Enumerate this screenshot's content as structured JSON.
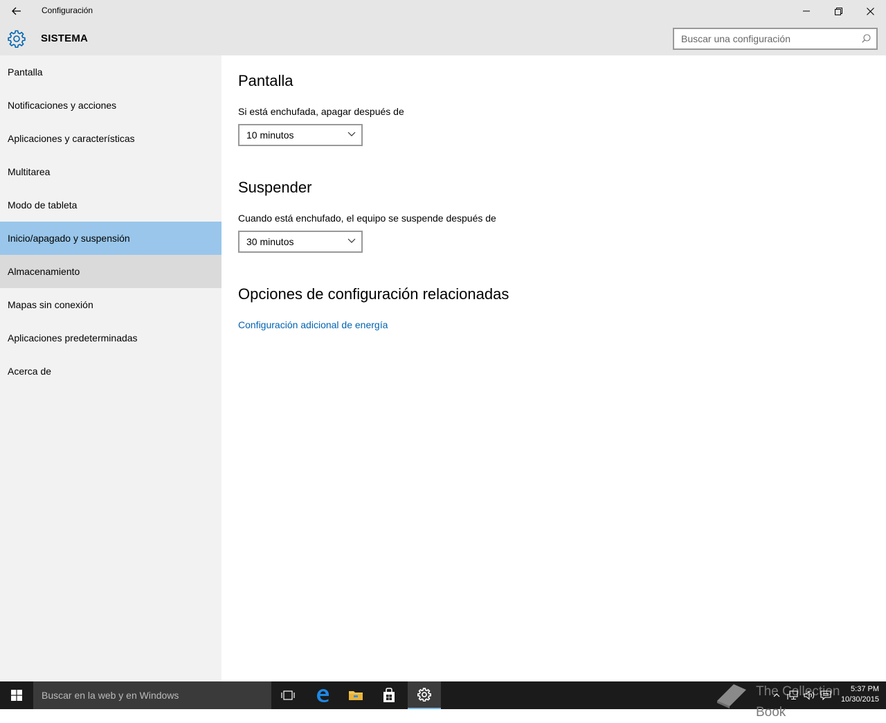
{
  "window": {
    "title": "Configuración",
    "section_title": "SISTEMA"
  },
  "search": {
    "placeholder": "Buscar una configuración"
  },
  "sidebar": {
    "items": [
      {
        "label": "Pantalla"
      },
      {
        "label": "Notificaciones y acciones"
      },
      {
        "label": "Aplicaciones y características"
      },
      {
        "label": "Multitarea"
      },
      {
        "label": "Modo de tableta"
      },
      {
        "label": "Inicio/apagado y suspensión"
      },
      {
        "label": "Almacenamiento"
      },
      {
        "label": "Mapas sin conexión"
      },
      {
        "label": "Aplicaciones predeterminadas"
      },
      {
        "label": "Acerca de"
      }
    ],
    "selected_label": "Inicio/apagado y suspensión"
  },
  "main": {
    "screen": {
      "heading": "Pantalla",
      "label": "Si está enchufada, apagar después de",
      "value": "10 minutos"
    },
    "sleep": {
      "heading": "Suspender",
      "label": "Cuando está enchufado, el equipo se suspende después de",
      "value": "30 minutos"
    },
    "related": {
      "heading": "Opciones de configuración relacionadas",
      "link": "Configuración adicional de energía"
    }
  },
  "taskbar": {
    "search_placeholder": "Buscar en la web y en Windows",
    "time": "5:37 PM",
    "date": "10/30/2015",
    "watermark": "The Collection Book"
  },
  "colors": {
    "accent": "#0063b1",
    "selected_bg": "#99c6ea",
    "hover_bg": "#dadada",
    "sidebar_bg": "#f2f2f2",
    "chrome_bg": "#e6e6e6",
    "taskbar_bg": "#1b1b1b"
  },
  "icons": {
    "back": "back-arrow-icon",
    "settings": "gear-icon",
    "search": "search-icon",
    "minimize": "minimize-icon",
    "restore": "restore-icon",
    "close": "close-icon"
  }
}
